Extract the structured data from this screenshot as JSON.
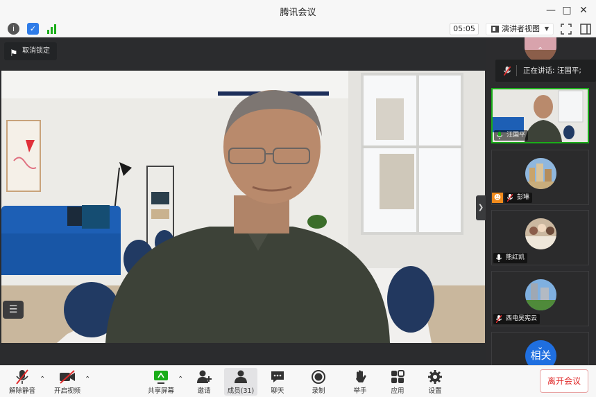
{
  "window": {
    "title": "腾讯会议"
  },
  "toolbar": {
    "timer": "05:05",
    "view_label": "演讲者视图"
  },
  "main": {
    "unlock_label": "取消锁定"
  },
  "speaking": {
    "text": "正在讲话: 汪国平;"
  },
  "participants": [
    {
      "name": "汪国平"
    },
    {
      "name": "彭琳"
    },
    {
      "name": "熊红凯"
    },
    {
      "name": "西电吴宪云"
    },
    {
      "name": "相关"
    }
  ],
  "bottom": {
    "unmute": "解除静音",
    "start_video": "开启视频",
    "share": "共享屏幕",
    "invite": "邀请",
    "members": "成员(31)",
    "chat": "聊天",
    "record": "录制",
    "raise_hand": "举手",
    "apps": "应用",
    "settings": "设置",
    "leave": "离开会议"
  },
  "colors": {
    "leave_red": "#e02a2a",
    "active_green": "#1aad19",
    "bar_bg": "#f7f7f7"
  }
}
